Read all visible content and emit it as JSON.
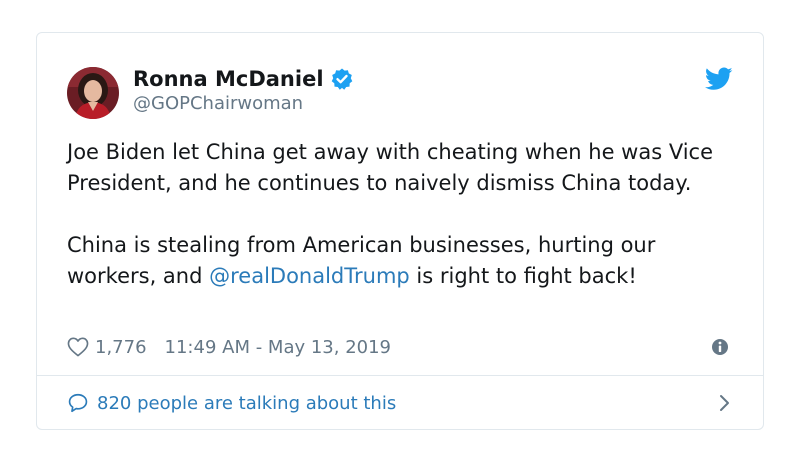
{
  "tweet": {
    "author": {
      "display_name": "Ronna McDaniel",
      "handle": "@GOPChairwoman",
      "verified": true
    },
    "body": {
      "paragraph1": "Joe Biden let China get away with cheating when he was Vice President, and he continues to naively dismiss China today.",
      "paragraph2_before": "China is stealing from American businesses, hurting our workers, and ",
      "mention": "@realDonaldTrump",
      "paragraph2_after": " is right to fight back!"
    },
    "likes": "1,776",
    "timestamp": "11:49 AM - May 13, 2019",
    "footer_text": "820 people are talking about this"
  },
  "icons": {
    "verified": "verified-badge-icon",
    "bird": "twitter-bird-icon",
    "heart": "heart-icon",
    "info": "info-icon",
    "bubble": "speech-bubble-icon",
    "chevron": "chevron-right-icon"
  },
  "colors": {
    "accent": "#1da1f2",
    "link": "#2b7bb9",
    "text": "#14171a",
    "muted": "#657786",
    "border": "#e1e8ed"
  }
}
